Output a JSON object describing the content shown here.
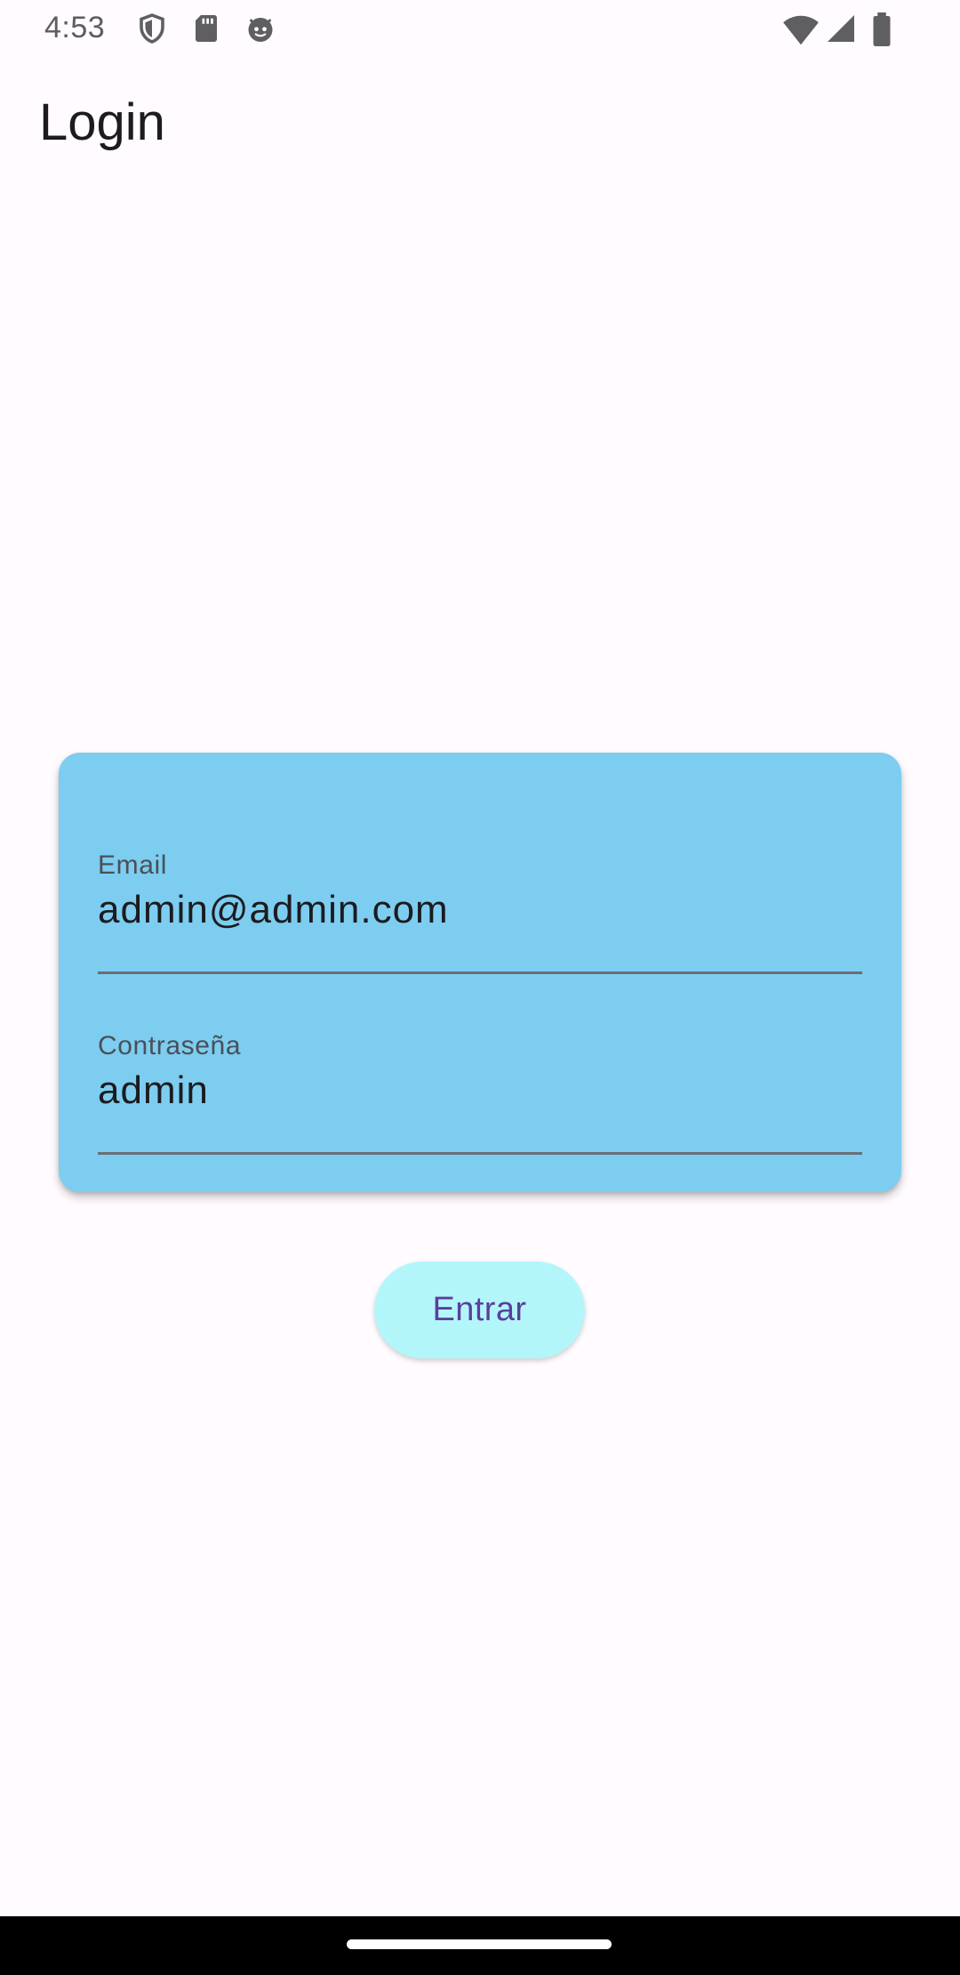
{
  "status_bar": {
    "time": "4:53",
    "icons": [
      "shield-icon",
      "sd-card-icon",
      "android-face-icon",
      "wifi-icon",
      "cell-signal-icon",
      "battery-icon"
    ]
  },
  "app_bar": {
    "title": "Login"
  },
  "login_card": {
    "color": "#7ccdf0",
    "email": {
      "label": "Email",
      "value": "admin@admin.com"
    },
    "password": {
      "label": "Contraseña",
      "value": "admin"
    }
  },
  "submit_button": {
    "label": "Entrar",
    "background": "#b3f6fa",
    "text_color": "#5a3f9e"
  }
}
